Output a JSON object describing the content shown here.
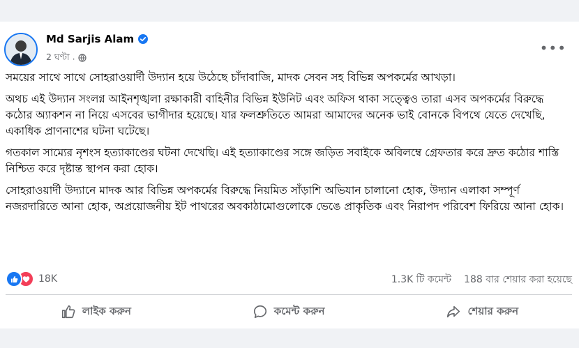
{
  "post": {
    "author": "Md Sarjis Alam",
    "time": "2 ঘণ্টা",
    "paragraphs": [
      "সময়ের সাথে সাথে সোহরাওয়ার্দী উদ্যান হয়ে উঠেছে চাঁদাবাজি, মাদক সেবন সহ বিভিন্ন অপকর্মের আখড়া।",
      "অথচ এই উদ্যান সংলগ্ন আইনশৃঙ্খলা রক্ষাকারী বাহিনীর বিভিন্ন ইউনিট এবং অফিস থাকা সত্ত্বেও তারা এসব অপকর্মের বিরুদ্ধে কঠোর অ্যাকশন না নিয়ে এসবের ভাগীদার হয়েছে। যার ফলশ্রুতিতে আমরা আমাদের অনেক ভাই বোনকে বিপথে যেতে দেখেছি, একাধিক প্রাণনাশের ঘটনা ঘটেছে।",
      "গতকাল সাম্যের নৃশংস হত্যাকাণ্ডের ঘটনা দেখেছি। এই হত্যাকাণ্ডের সঙ্গে জড়িত সবাইকে অবিলম্বে গ্রেফতার করে দ্রুত কঠোর শাস্তি নিশ্চিত করে দৃষ্টান্ত স্থাপন করা হোক।",
      "সোহরাওয়ার্দী উদ্যানে মাদক আর বিভিন্ন অপকর্মের বিরুদ্ধে নিয়মিত সাঁড়াশি অভিযান চালানো হোক, উদ্যান এলাকা সম্পূর্ণ নজরদারিতে আনা হোক, অপ্রয়োজনীয় ইট পাথরের অবকাঠামোগুলোকে ভেঙে প্রাকৃতিক এবং নিরাপদ পরিবেশ ফিরিয়ে আনা হোক।"
    ],
    "reactions_count": "18K",
    "comments_count": "1.3K টি কমেন্ট",
    "shares_count": "188 বার শেয়ার করা হয়েছে"
  },
  "actions": {
    "like": "লাইক করুন",
    "comment": "কমেন্ট করুন",
    "share": "শেয়ার করুন"
  },
  "icons": {
    "verified": "verified-badge-icon",
    "audience": "globe-icon",
    "more": "more-options-icon",
    "like_reaction": "like-reaction-icon",
    "love_reaction": "love-reaction-icon"
  },
  "colors": {
    "brand_blue": "#1877f2",
    "love_red": "#f33e58",
    "secondary_text": "#65676b",
    "primary_text": "#050505"
  }
}
